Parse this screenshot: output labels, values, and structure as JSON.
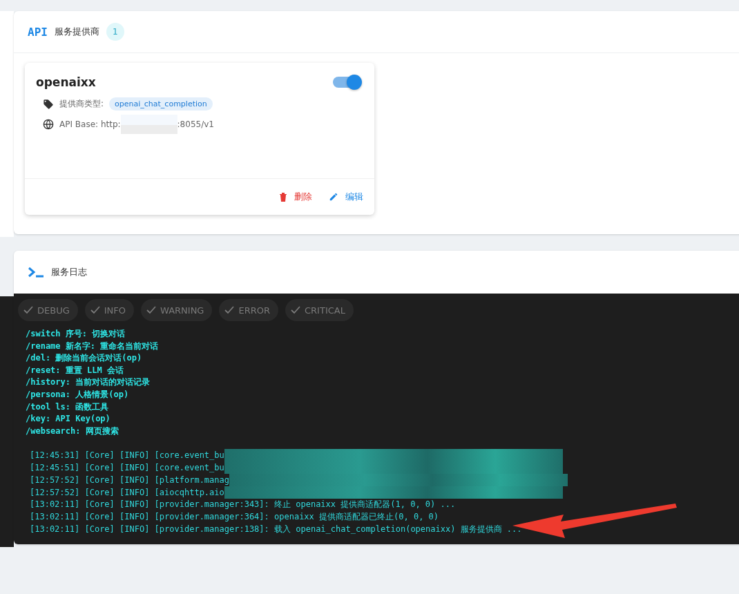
{
  "providers_panel": {
    "icon_text": "API",
    "title": "服务提供商",
    "count": "1",
    "providers": [
      {
        "name": "openaixx",
        "enabled": true,
        "type_label": "提供商类型:",
        "type": "openai_chat_completion",
        "api_base_prefix": "API Base: http:",
        "api_base_suffix": ":8055/v1",
        "redacted": true,
        "actions": [
          {
            "kind": "delete",
            "label": "删除"
          },
          {
            "kind": "edit",
            "label": "编辑"
          }
        ]
      }
    ]
  },
  "log_panel": {
    "title": "服务日志",
    "filters": [
      {
        "label": "DEBUG",
        "selected": true
      },
      {
        "label": "INFO",
        "selected": true
      },
      {
        "label": "WARNING",
        "selected": true
      },
      {
        "label": "ERROR",
        "selected": true
      },
      {
        "label": "CRITICAL",
        "selected": true
      }
    ],
    "help_lines": [
      "/switch 序号: 切换对话",
      "/rename 新名字: 重命名当前对话",
      "/del: 删除当前会话对话(op)",
      "/reset: 重置 LLM 会话",
      "/history: 当前对话的对话记录",
      "/persona: 人格情景(op)",
      "/tool ls: 函数工具",
      "/key: API Key(op)",
      "/websearch: 网页搜索"
    ],
    "log_lines": [
      {
        "text": "[12:45:31] [Core] [INFO] [core.event_bu",
        "redacted": true
      },
      {
        "text": "[12:45:51] [Core] [INFO] [core.event_bu",
        "redacted": true
      },
      {
        "text": "[12:57:52] [Core] [INFO] [platform.manag",
        "redacted": true
      },
      {
        "text": "[12:57:52] [Core] [INFO] [aiocqhttp.aio",
        "redacted": true
      },
      {
        "text": "[13:02:11] [Core] [INFO] [provider.manager:343]: 终止 openaixx 提供商适配器(1, 0, 0) ...",
        "redacted": false
      },
      {
        "text": "[13:02:11] [Core] [INFO] [provider.manager:364]: openaixx 提供商适配器已终止(0, 0, 0)",
        "redacted": false
      },
      {
        "text": "[13:02:11] [Core] [INFO] [provider.manager:138]: 载入 openai_chat_completion(openaixx) 服务提供商 ...",
        "redacted": false
      }
    ],
    "annotation_arrow": true
  }
}
